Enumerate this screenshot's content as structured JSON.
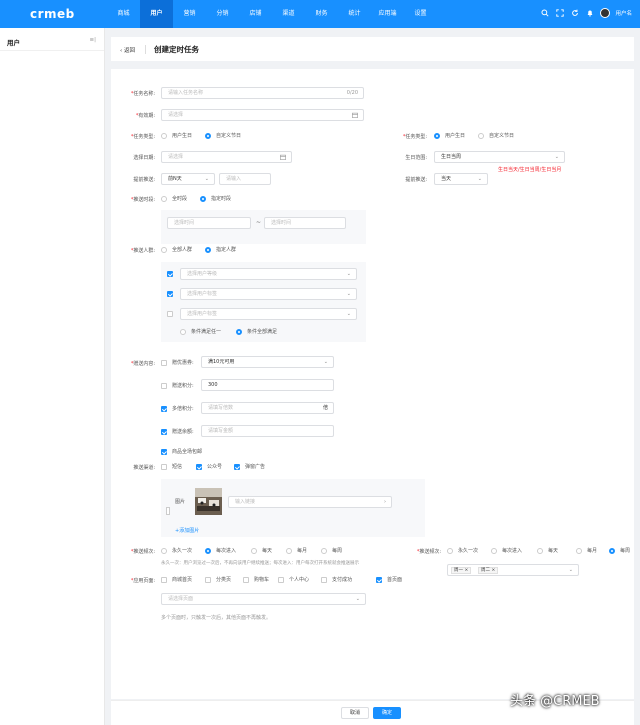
{
  "brand": {
    "logo": "crmeb",
    "accent": "#1890ff"
  },
  "nav": [
    "商城",
    "用户",
    "营销",
    "分销",
    "店铺",
    "渠道",
    "财务",
    "统计",
    "应用端",
    "设置"
  ],
  "user": {
    "name": "用户名"
  },
  "sidebar": {
    "title": "用户",
    "collapse": "≡|"
  },
  "header": {
    "back": "返回",
    "title": "创建定时任务"
  },
  "form": {
    "task_name": {
      "label": "任务名称:",
      "placeholder": "请输入任务名称",
      "counter": "0/20"
    },
    "valid_period": {
      "label": "有效期:",
      "placeholder": "请选择"
    },
    "task_type_left": {
      "label": "任务类型:",
      "options": [
        "用户生日",
        "自定义节日"
      ]
    },
    "task_type_right": {
      "label": "任务类型:",
      "options": [
        "用户生日",
        "自定义节日"
      ]
    },
    "select_date": {
      "label": "选择日期:",
      "placeholder": "请选择"
    },
    "birthday_range": {
      "label": "生日范围:",
      "value": "生日当周",
      "error": "生日当天/生日当周/生日当月"
    },
    "advance_push_left": {
      "label": "提前推送:",
      "value": "前N天",
      "placeholder": "请输入"
    },
    "advance_push_right": {
      "label": "提前推送:",
      "value": "当天"
    },
    "push_time": {
      "label": "推送时段:",
      "options": [
        "全时段",
        "指定时段"
      ],
      "start_placeholder": "选择时间",
      "sep": "~",
      "end_placeholder": "选择时间"
    },
    "push_crowd": {
      "label": "推送人群:",
      "options": [
        "全部人群",
        "指定人群"
      ],
      "selects": [
        "选择用户等级",
        "选择用户标签",
        "选择用户标签"
      ],
      "match_options": [
        "条件满足任一",
        "条件全部满足"
      ]
    },
    "gift": {
      "label": "赠送内容:",
      "coupon_label": "赠优惠券:",
      "coupon_value": "满10元可用",
      "points_label": "赠送积分:",
      "points_value": "300",
      "multi_label": "多倍积分:",
      "multi_placeholder": "请填写倍数",
      "multi_unit": "倍",
      "balance_label": "赠送余额:",
      "balance_placeholder": "请填写金额",
      "shipping_label": "商品全场包邮"
    },
    "channel": {
      "label": "推送渠道:",
      "options": [
        "短信",
        "公众号",
        "弹窗广告"
      ],
      "image_label": "图片",
      "link_placeholder": "输入链接",
      "add_image": "+添加图片"
    },
    "frequency_left": {
      "label": "推送频次:",
      "options": [
        "永久一次",
        "每次进入",
        "每天",
        "每月",
        "每周"
      ]
    },
    "frequency_right": {
      "label": "推送频次:",
      "options": [
        "永久一次",
        "每次进入",
        "每天",
        "每月",
        "每周"
      ],
      "tags": [
        "周一",
        "周二"
      ],
      "tag_close": "×"
    },
    "freq_hint": "永久一次：用户浏览过一次后，不再向该用户继续推送；每次进入：用户每次打开系统就会推送展示",
    "apply_page": {
      "label": "应用页面:",
      "options": [
        "商城首页",
        "分类页",
        "购物车",
        "个人中心",
        "支付成功",
        "首页面"
      ],
      "placeholder": "请选择页面",
      "hint": "多个页面时，只触发一次后，其他页面不再触发。"
    }
  },
  "footer": {
    "cancel": "取消",
    "ok": "确定"
  },
  "watermark": "头条 @CRMEB"
}
